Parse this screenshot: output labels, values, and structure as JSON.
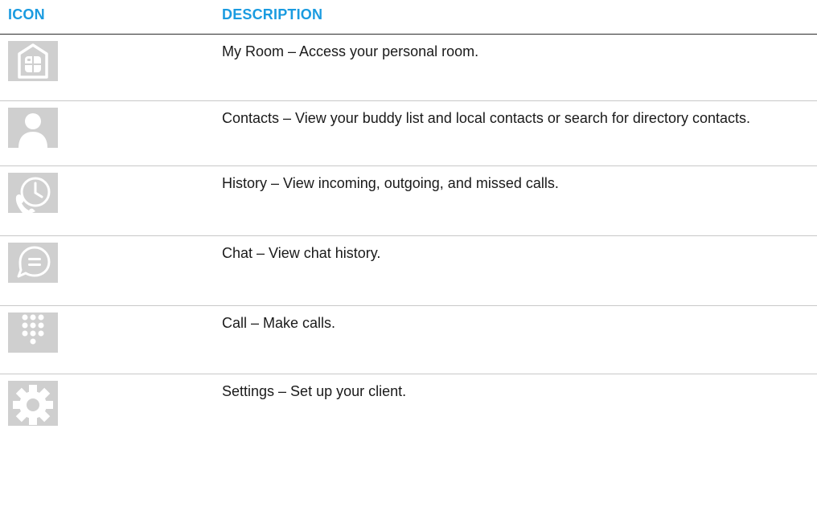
{
  "headers": {
    "icon": "ICON",
    "description": "DESCRIPTION"
  },
  "rows": [
    {
      "icon": "my-room-icon",
      "text": "My Room – Access your personal room."
    },
    {
      "icon": "contacts-icon",
      "text": "Contacts – View your buddy list and local contacts or search for directory contacts."
    },
    {
      "icon": "history-icon",
      "text": "History – View incoming, outgoing, and missed calls."
    },
    {
      "icon": "chat-icon",
      "text": "Chat – View chat history."
    },
    {
      "icon": "dialpad-icon",
      "text": "Call – Make calls."
    },
    {
      "icon": "settings-icon",
      "text": "Settings – Set up your client."
    }
  ],
  "colors": {
    "header_text": "#1a9be0",
    "icon_bg": "#cfcfcf",
    "icon_fg": "#ffffff"
  }
}
